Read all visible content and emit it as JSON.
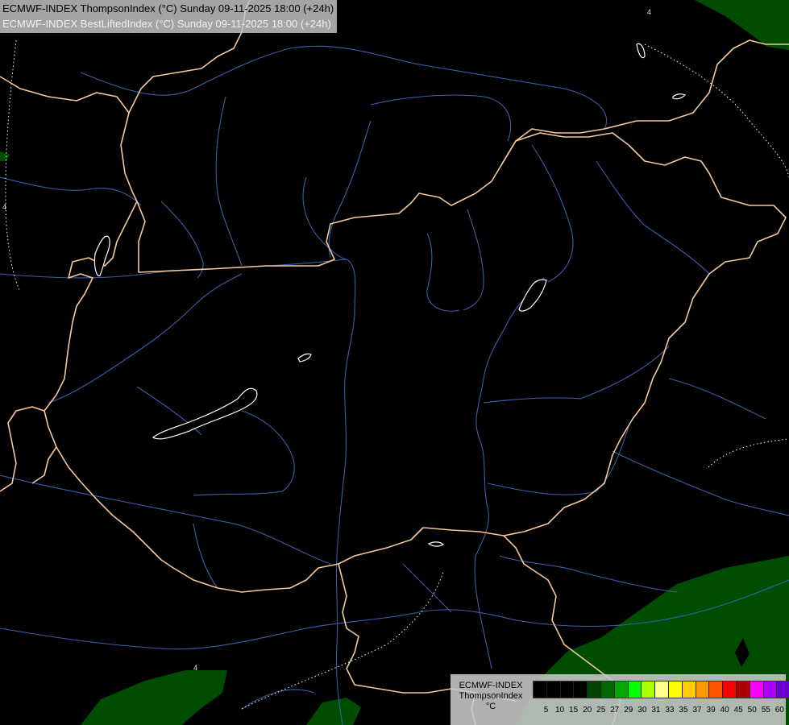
{
  "title": {
    "line1": "ECMWF-INDEX ThompsonIndex (°C) Sunday 09-11-2025 18:00 (+24h)",
    "line2": "ECMWF-INDEX BestLiftedIndex (°C) Sunday 09-11-2025 18:00 (+24h)"
  },
  "legend": {
    "label_model": "ECMWF-INDEX",
    "label_parameter": "ThompsonIndex",
    "label_unit": "°C",
    "ticks": [
      "5",
      "10",
      "15",
      "20",
      "25",
      "27",
      "29",
      "30",
      "31",
      "33",
      "35",
      "37",
      "39",
      "40",
      "45",
      "50",
      "55",
      "60"
    ],
    "colors": [
      "#000000",
      "#000000",
      "#000000",
      "#000000",
      "#004400",
      "#006600",
      "#00aa00",
      "#00ff00",
      "#aaff00",
      "#ffff88",
      "#ffff00",
      "#ffcc00",
      "#ff9900",
      "#ff5500",
      "#ff0000",
      "#aa0000",
      "#ff00ff",
      "#aa00ff",
      "#6600cc",
      "#0000ff"
    ]
  },
  "map": {
    "background_color": "#000000",
    "border_color": "#f5c89a",
    "river_color": "#3a5faa",
    "lake_outline_color": "#ffffff",
    "index_field_color": "#004d00",
    "isoline_label": "4"
  }
}
